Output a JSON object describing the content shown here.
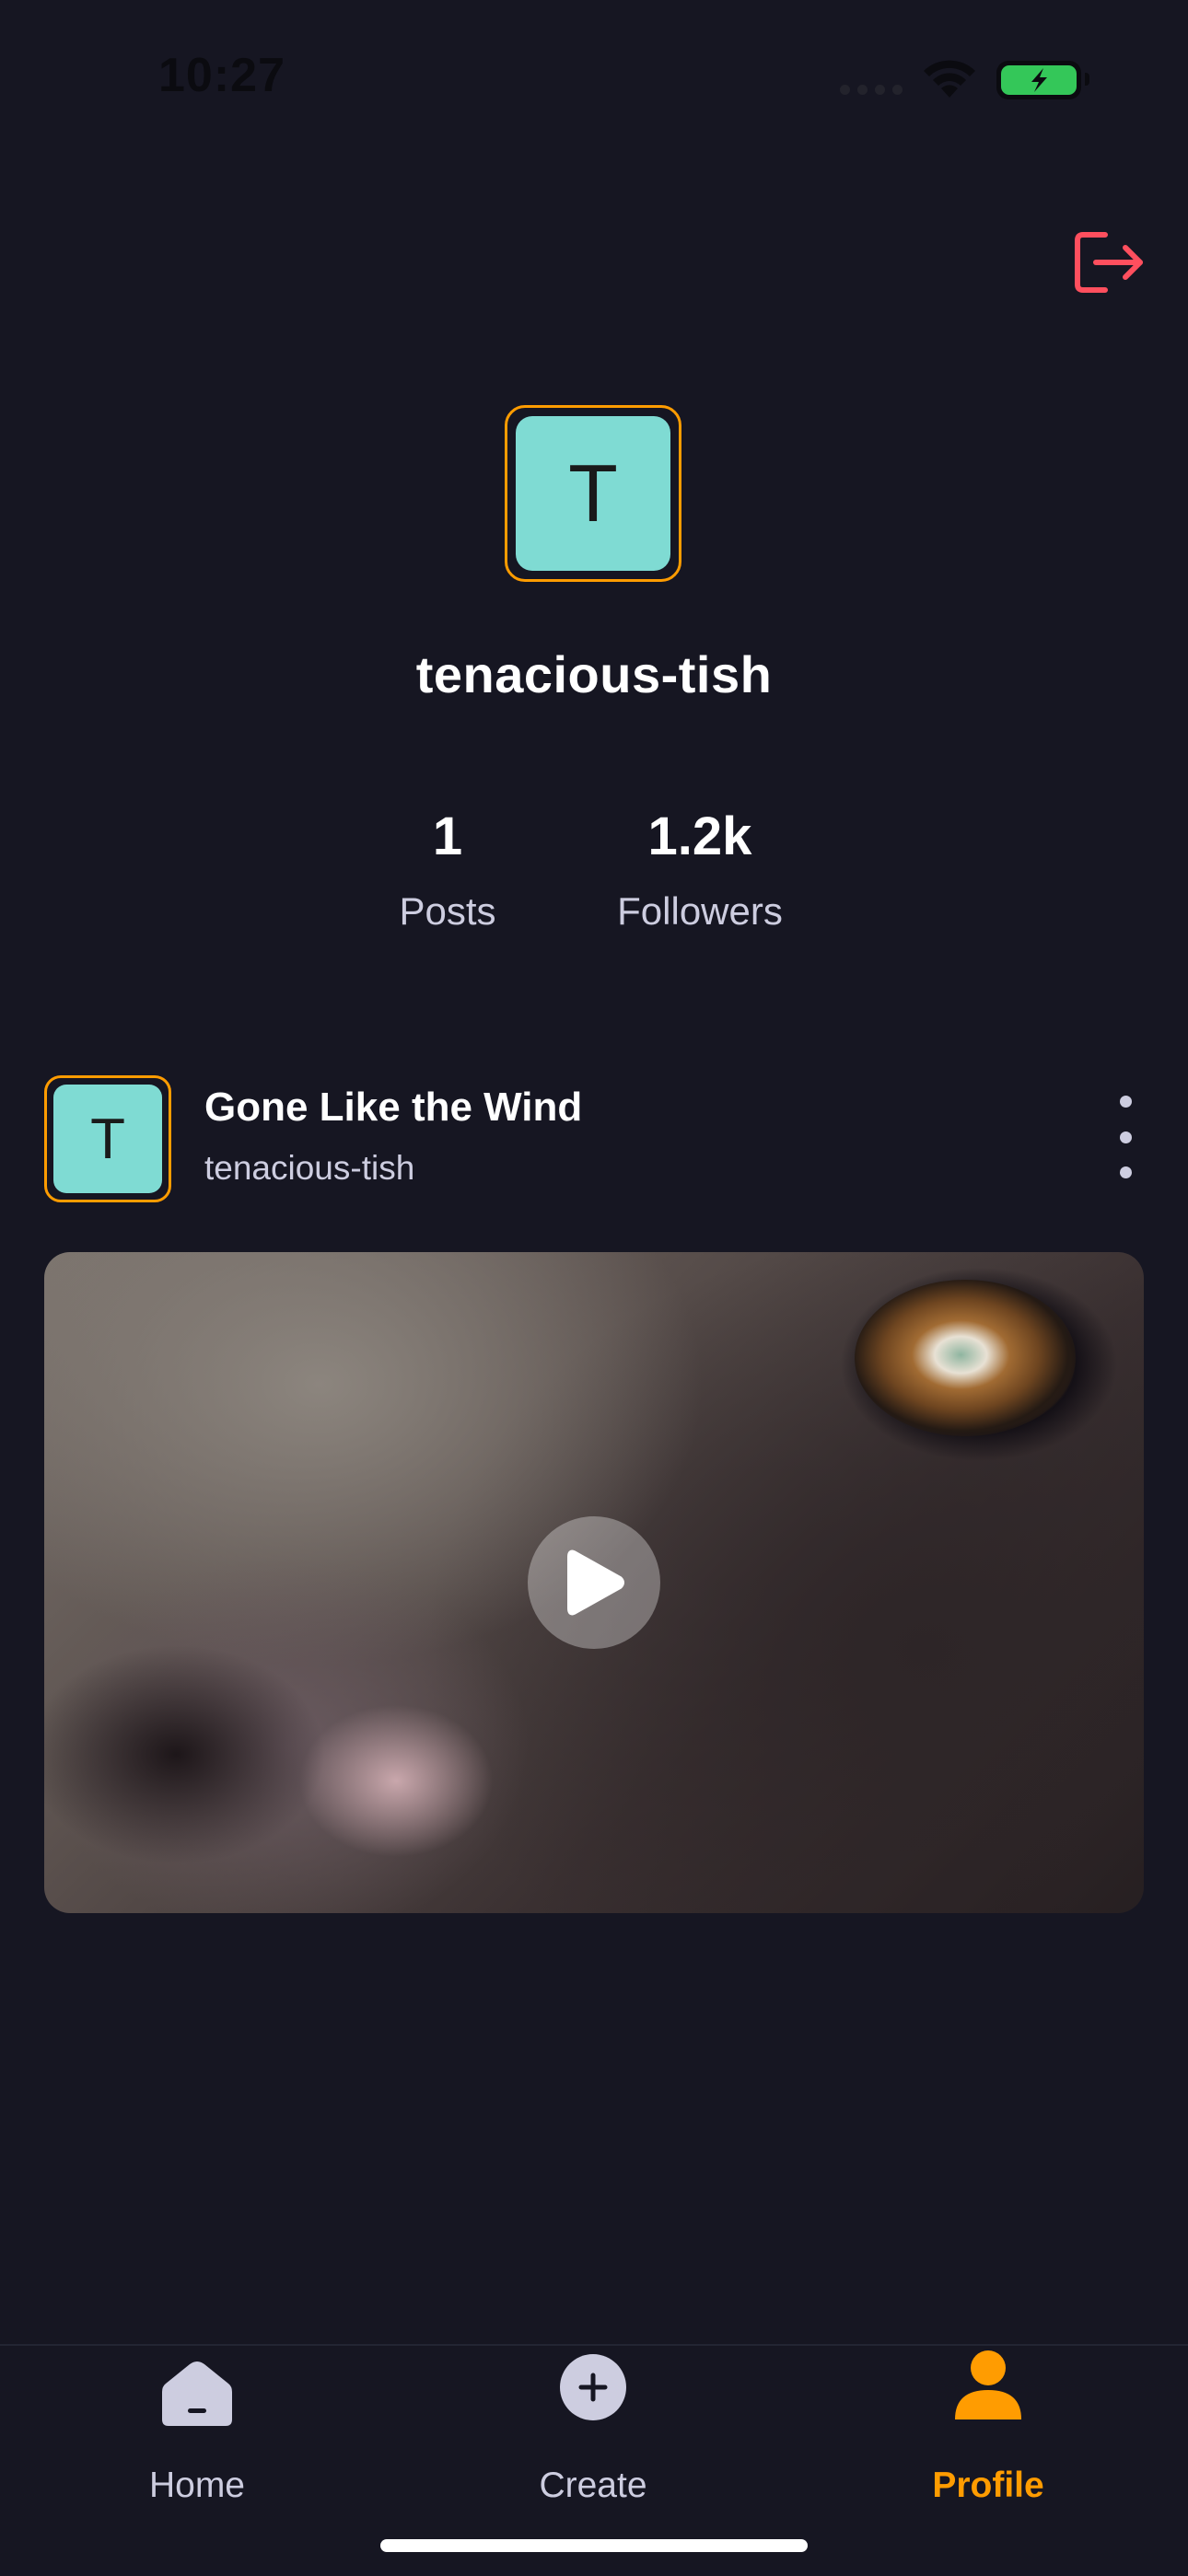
{
  "status_bar": {
    "time": "10:27"
  },
  "profile": {
    "avatar_letter": "T",
    "username": "tenacious-tish",
    "stats": [
      {
        "value": "1",
        "label": "Posts"
      },
      {
        "value": "1.2k",
        "label": "Followers"
      }
    ]
  },
  "post": {
    "avatar_letter": "T",
    "title": "Gone Like the Wind",
    "author": "tenacious-tish"
  },
  "tab_bar": {
    "tabs": [
      {
        "label": "Home",
        "icon": "home-icon",
        "active": false
      },
      {
        "label": "Create",
        "icon": "plus-icon",
        "active": false
      },
      {
        "label": "Profile",
        "icon": "profile-icon",
        "active": true
      }
    ]
  },
  "colors": {
    "background": "#161622",
    "accent": "#ff9c01",
    "avatar": "#7fdbd3",
    "logout": "#ff4f5e",
    "battery": "#34c759"
  }
}
